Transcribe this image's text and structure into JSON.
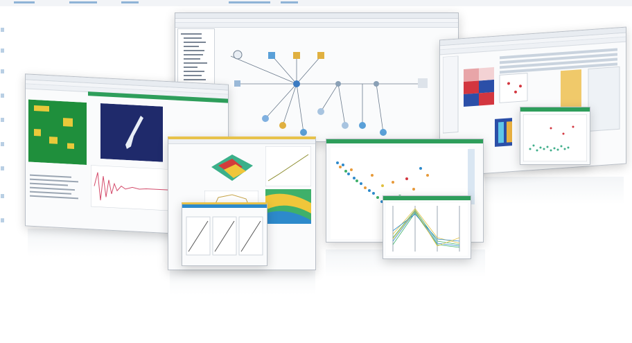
{
  "scene": {
    "description_label": "",
    "colors": {
      "green_accent": "#2e9e5b",
      "yellow_accent": "#e7c24a",
      "navy_plot": "#1f2a6b",
      "heat_red": "#d3363f",
      "heat_blue": "#2b4fa8"
    },
    "windows": [
      {
        "id": "workflow-window"
      },
      {
        "id": "heatmap-window"
      },
      {
        "id": "image-analysis-window"
      },
      {
        "id": "surface-plot-window"
      },
      {
        "id": "scatter-window"
      },
      {
        "id": "parallel-coords-window"
      }
    ]
  }
}
